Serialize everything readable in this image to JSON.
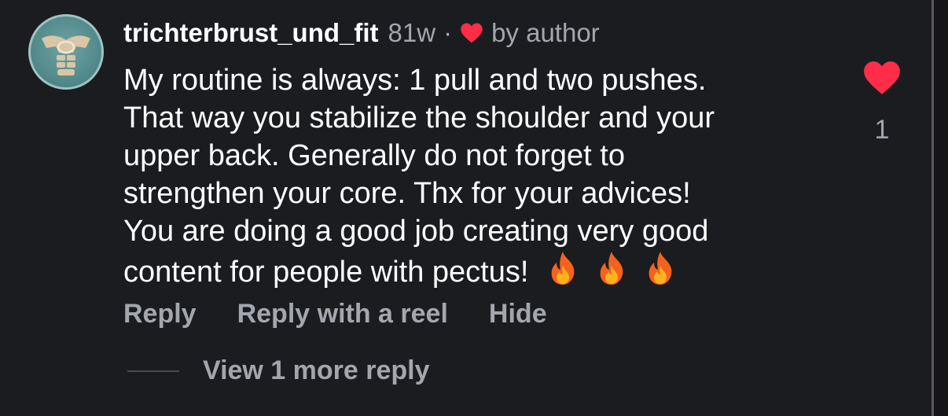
{
  "comment": {
    "username": "trichterbrust_und_fit",
    "age": "81w",
    "separator": "·",
    "liked_by_author_label": "by author",
    "text_lines": [
      "My routine is always: 1 pull and two pushes.",
      "That way you stabilize the shoulder and your",
      "upper back. Generally do not forget to",
      "strengthen your core. Thx for your advices!",
      "You are doing a good job creating very good",
      "content for people with pectus!"
    ],
    "emoji": [
      "fire-icon",
      "fire-icon",
      "fire-icon"
    ],
    "like_count": "1",
    "liked": true
  },
  "actions": {
    "reply_label": "Reply",
    "reply_reel_label": "Reply with a reel",
    "hide_label": "Hide"
  },
  "replies": {
    "view_more_label": "View 1 more reply"
  },
  "colors": {
    "background": "#1b1c20",
    "text_primary": "#ffffff",
    "text_secondary": "#a4a6ad",
    "heart": "#ff2d47"
  }
}
